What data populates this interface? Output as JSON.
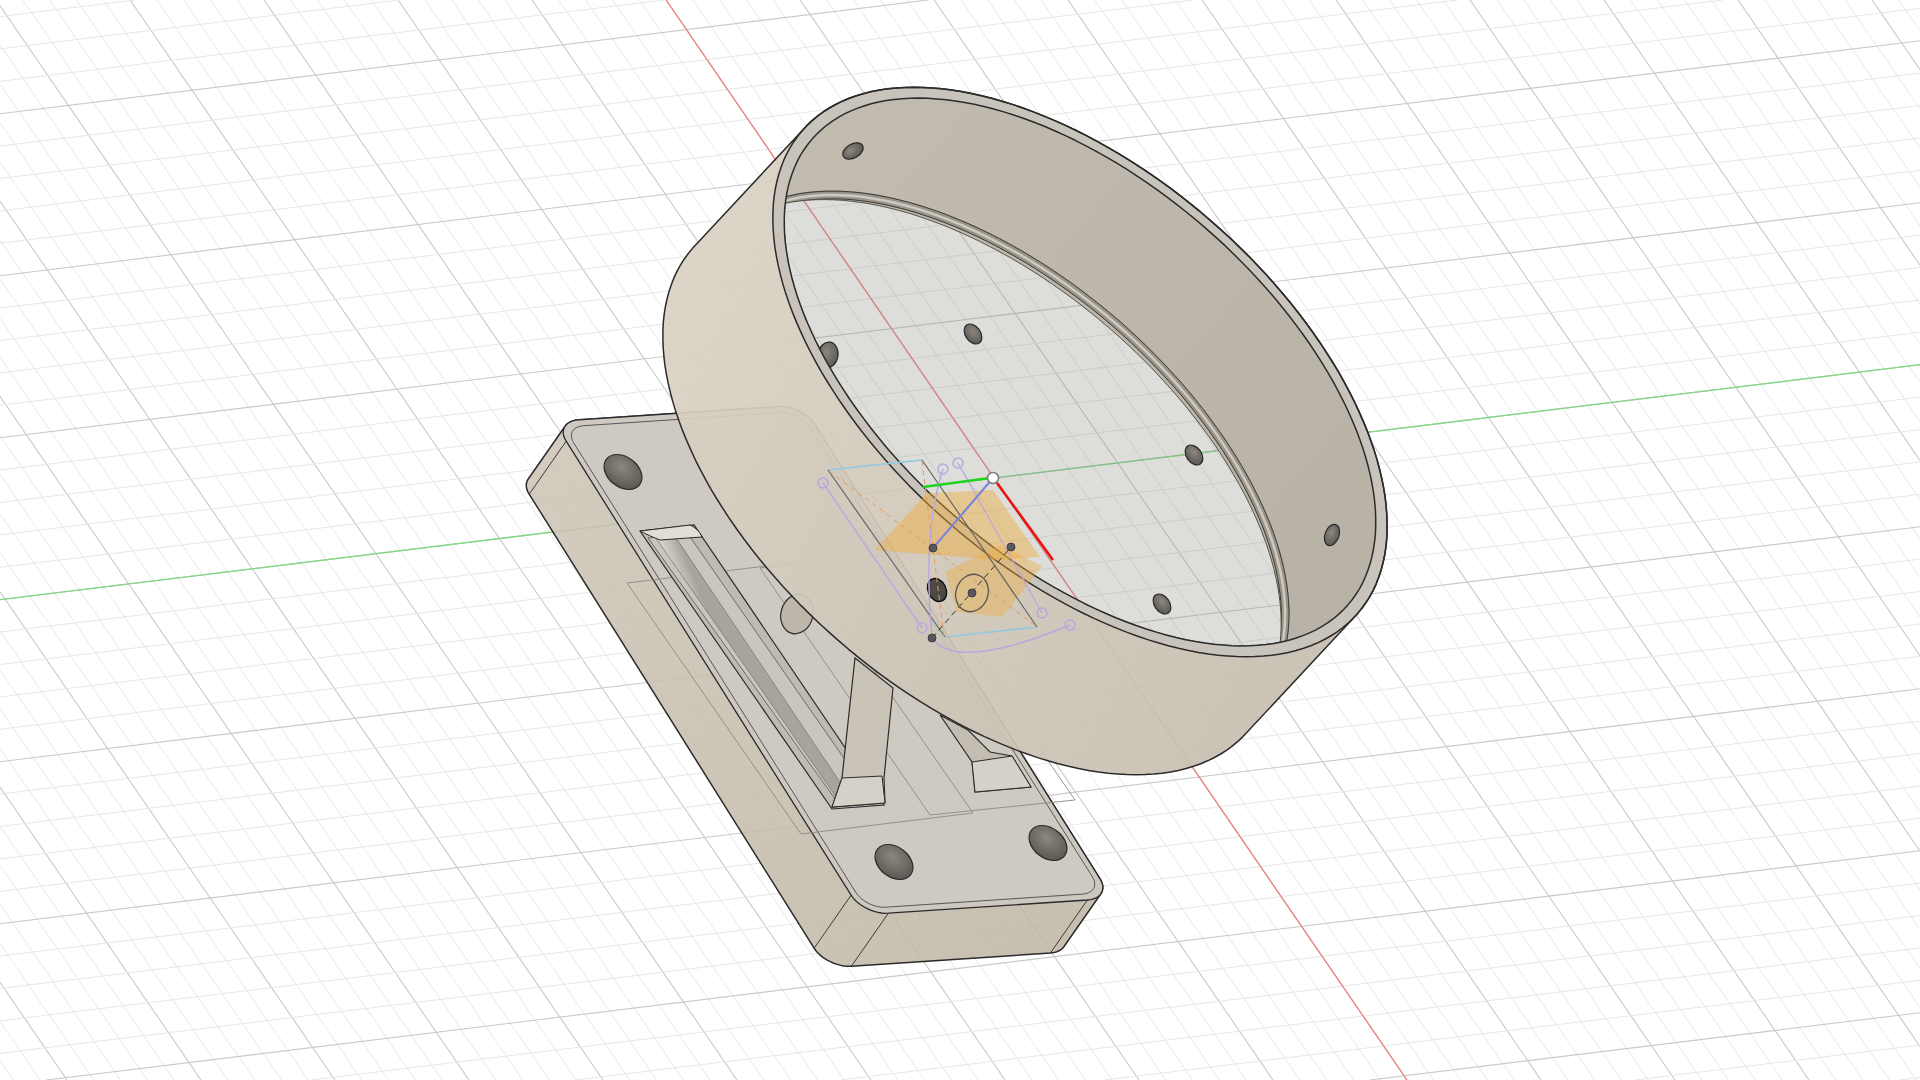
{
  "viewport": {
    "axes": [
      {
        "kind": "x",
        "color": "#f08080"
      },
      {
        "kind": "y",
        "color": "#80d880"
      }
    ]
  }
}
